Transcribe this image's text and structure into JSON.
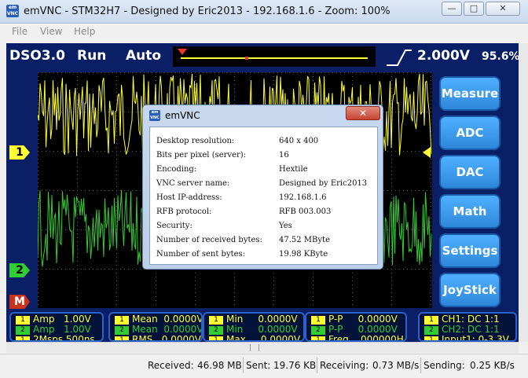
{
  "window": {
    "title": "emVNC - STM32H7 - Designed by Eric2013 - 192.168.1.6 - Zoom: 100%",
    "icon_text": "em VNC",
    "minimize_glyph": "—",
    "maximize_glyph": "□",
    "close_glyph": "✕"
  },
  "menu": [
    "File",
    "View",
    "Help"
  ],
  "scope": {
    "brand": "DSO3.0",
    "run_state": "Run",
    "trigger_mode": "Auto",
    "volts_div": "2.000V",
    "trigger_pct": "95.6%",
    "ch1_marker": "1",
    "ch2_marker": "2",
    "math_marker": "M",
    "colors": {
      "ch1": "#ffff33",
      "ch2": "#33cc33",
      "background": "#0a1f66",
      "button": "#2e88d9",
      "trigger": "#e8342a"
    }
  },
  "side_buttons": [
    "Measure",
    "ADC",
    "DAC",
    "Math",
    "Settings",
    "JoyStick"
  ],
  "panel1": [
    {
      "idx": "1",
      "text": "Amp   1.00V",
      "color": "#ffff33"
    },
    {
      "idx": "2",
      "text": "Amp   1.00V",
      "color": "#33cc33"
    },
    {
      "idx": "1",
      "text": "2Msps 500ns",
      "color": "#ffff33"
    }
  ],
  "panel2": [
    {
      "idx": "1",
      "text": "Mean  0.0000V",
      "color": "#ffff33"
    },
    {
      "idx": "2",
      "text": "Mean  0.0000V",
      "color": "#33cc33"
    },
    {
      "idx": "1",
      "text": "RMS   0.0000V",
      "color": "#ffff33"
    }
  ],
  "panel3": [
    {
      "idx": "1",
      "text": "Min     0.0000V",
      "color": "#ffff33"
    },
    {
      "idx": "2",
      "text": "Min     0.0000V",
      "color": "#33cc33"
    },
    {
      "idx": "1",
      "text": "Max     0.0000V",
      "color": "#ffff33"
    }
  ],
  "panel4": [
    {
      "idx": "1",
      "text": "P-P     0.0000V",
      "color": "#ffff33"
    },
    {
      "idx": "2",
      "text": "P-P     0.0000V",
      "color": "#33cc33"
    },
    {
      "idx": "1",
      "text": "Freq    000000H",
      "color": "#ffff33"
    }
  ],
  "panel5": [
    {
      "idx": "1",
      "text": "CH1: DC 1:1",
      "color": "#ffff33"
    },
    {
      "idx": "2",
      "text": "CH2: DC 1:1",
      "color": "#33cc33"
    },
    {
      "idx": "1",
      "text": "Input1: 0-3.3V",
      "color": "#ffff33"
    }
  ],
  "status": {
    "received_label": "Received:",
    "received_value": "46.98 MB",
    "sent_label": "Sent:",
    "sent_value": "19.76 KB",
    "receiving_label": "Receiving:",
    "receiving_value": "0.73 MB/s",
    "sending_label": "Sending:",
    "sending_value": "0.25 KB/s"
  },
  "dialog": {
    "title": "emVNC",
    "close_glyph": "✕",
    "rows": [
      {
        "label": "Desktop resolution:",
        "value": "640 x 400"
      },
      {
        "label": "Bits per pixel (server):",
        "value": "16"
      },
      {
        "label": "Encoding:",
        "value": "Hextile"
      },
      {
        "label": "VNC server name:",
        "value": "Designed by Eric2013"
      },
      {
        "label": "Host IP-address:",
        "value": "192.168.1.6"
      },
      {
        "label": "RFB protocol:",
        "value": "RFB 003.003"
      },
      {
        "label": "Security:",
        "value": "Yes"
      },
      {
        "label": "Number of received bytes:",
        "value": "47.52 MByte"
      },
      {
        "label": "Number of sent bytes:",
        "value": "19.98 KByte"
      }
    ]
  }
}
